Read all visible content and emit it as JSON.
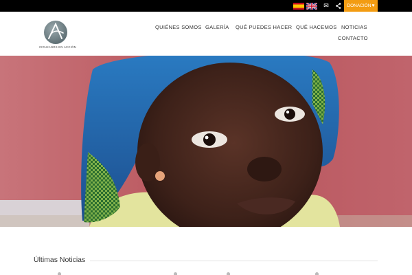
{
  "topbar": {
    "languages": [
      {
        "name": "spanish-flag-icon"
      },
      {
        "name": "uk-flag-icon"
      }
    ],
    "icons": [
      "mail-icon",
      "share-icon"
    ],
    "donate_label": "DONACIÓN",
    "donate_icon": "heart-icon",
    "accent_color": "#f39c12"
  },
  "header": {
    "logo_text": "CIRUJANOS EN ACCIÓN",
    "nav": [
      {
        "label": "QUIÉNES SOMOS"
      },
      {
        "label": "GALERÍA"
      },
      {
        "label": "QUÉ PUEDES HACER"
      },
      {
        "label": "QUÉ HACEMOS"
      },
      {
        "label": "NOTICIAS"
      },
      {
        "label": "CONTACTO"
      }
    ]
  },
  "hero": {
    "description_icon": "hero-photo"
  },
  "news": {
    "title": "Últimas Noticias"
  }
}
